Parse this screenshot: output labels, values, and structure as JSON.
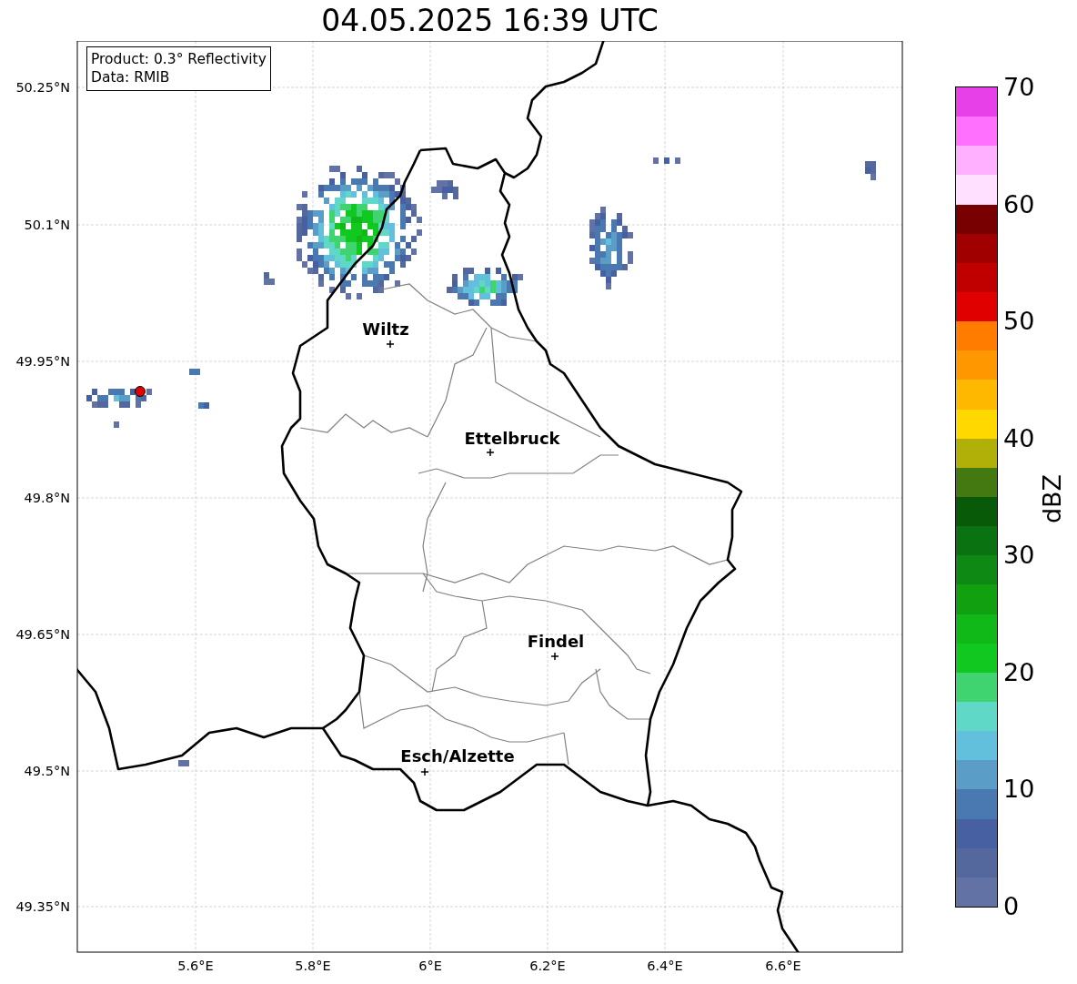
{
  "title": "04.05.2025 16:39 UTC",
  "info_box": {
    "lines": [
      "Product: 0.3° Reflectivity",
      "Data: RMIB"
    ]
  },
  "map": {
    "latitude_labels": [
      "50.25°N",
      "50.1°N",
      "49.95°N",
      "49.8°N",
      "49.65°N",
      "49.5°N",
      "49.35°N"
    ],
    "longitude_labels": [
      "5.6°E",
      "5.8°E",
      "6°E",
      "6.2°E",
      "6.4°E",
      "6.6°E"
    ],
    "cities": [
      {
        "name": "Wiltz"
      },
      {
        "name": "Ettelbruck"
      },
      {
        "name": "Findel"
      },
      {
        "name": "Esch/Alzette"
      }
    ]
  },
  "colorbar": {
    "label": "dBZ",
    "tick_labels": [
      "70",
      "60",
      "50",
      "40",
      "30",
      "20",
      "10",
      "0"
    ],
    "bins": [
      {
        "color": "#e840e8"
      },
      {
        "color": "#ff70ff"
      },
      {
        "color": "#ffb0ff"
      },
      {
        "color": "#ffe0ff"
      },
      {
        "color": "#780000"
      },
      {
        "color": "#a00000"
      },
      {
        "color": "#c00000"
      },
      {
        "color": "#e00000"
      },
      {
        "color": "#ff7c00"
      },
      {
        "color": "#ff9800"
      },
      {
        "color": "#ffb800"
      },
      {
        "color": "#ffd800"
      },
      {
        "color": "#b0b008"
      },
      {
        "color": "#447810"
      },
      {
        "color": "#085a08"
      },
      {
        "color": "#0a7210"
      },
      {
        "color": "#0e8a14"
      },
      {
        "color": "#10a010"
      },
      {
        "color": "#10b818"
      },
      {
        "color": "#10c820"
      },
      {
        "color": "#40d470"
      },
      {
        "color": "#60d8c8"
      },
      {
        "color": "#62c0dc"
      },
      {
        "color": "#5a9ec8"
      },
      {
        "color": "#4a78b0"
      },
      {
        "color": "#4660a2"
      },
      {
        "color": "#54689e"
      },
      {
        "color": "#6272a4"
      }
    ]
  }
}
